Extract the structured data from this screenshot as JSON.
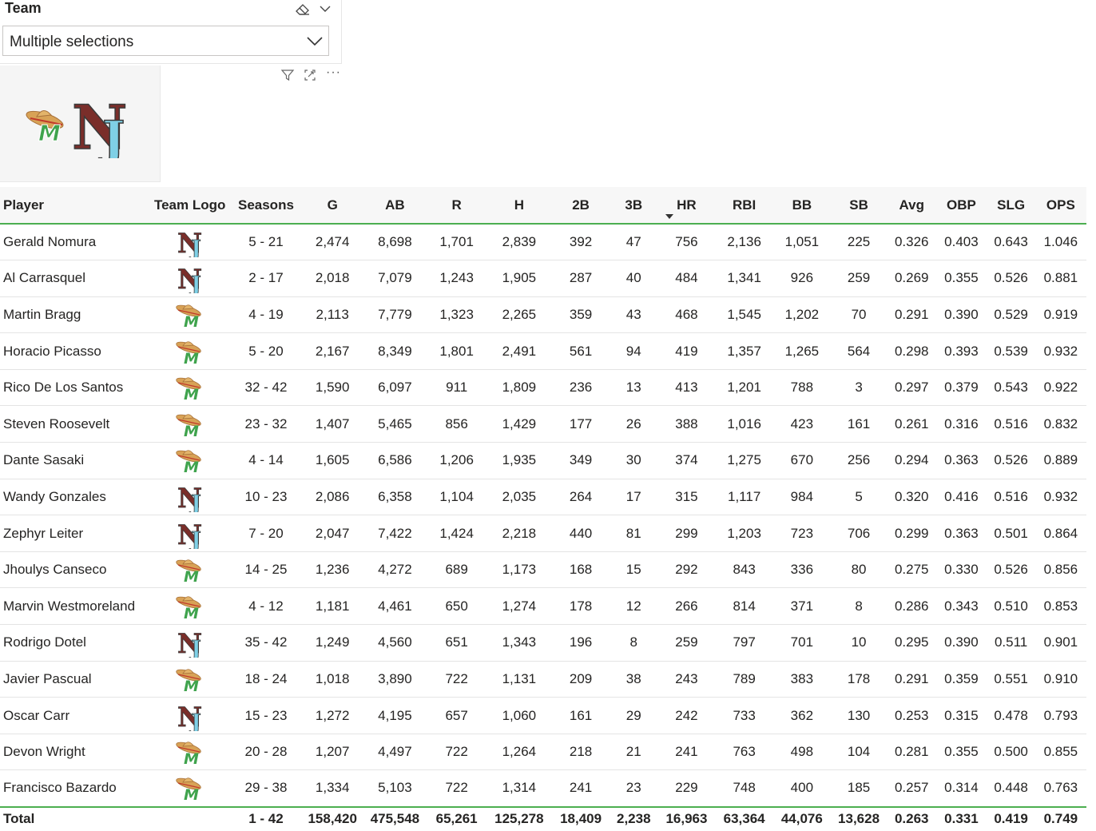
{
  "slicer": {
    "title": "Team",
    "value": "Multiple selections"
  },
  "logos": {
    "m_logo_text": "M",
    "nj_logo_text": "NJ"
  },
  "table": {
    "headers": [
      "Player",
      "Team Logo",
      "Seasons",
      "G",
      "AB",
      "R",
      "H",
      "2B",
      "3B",
      "HR",
      "RBI",
      "BB",
      "SB",
      "Avg",
      "OBP",
      "SLG",
      "OPS"
    ],
    "sorted_column": "HR",
    "rows": [
      {
        "player": "Gerald Nomura",
        "team": "nj",
        "seasons": "5 - 21",
        "g": "2,474",
        "ab": "8,698",
        "r": "1,701",
        "h": "2,839",
        "b2": "392",
        "b3": "47",
        "hr": "756",
        "rbi": "2,136",
        "bb": "1,051",
        "sb": "225",
        "avg": "0.326",
        "obp": "0.403",
        "slg": "0.643",
        "ops": "1.046"
      },
      {
        "player": "Al Carrasquel",
        "team": "nj",
        "seasons": "2 - 17",
        "g": "2,018",
        "ab": "7,079",
        "r": "1,243",
        "h": "1,905",
        "b2": "287",
        "b3": "40",
        "hr": "484",
        "rbi": "1,341",
        "bb": "926",
        "sb": "259",
        "avg": "0.269",
        "obp": "0.355",
        "slg": "0.526",
        "ops": "0.881"
      },
      {
        "player": "Martin Bragg",
        "team": "m",
        "seasons": "4 - 19",
        "g": "2,113",
        "ab": "7,779",
        "r": "1,323",
        "h": "2,265",
        "b2": "359",
        "b3": "43",
        "hr": "468",
        "rbi": "1,545",
        "bb": "1,202",
        "sb": "70",
        "avg": "0.291",
        "obp": "0.390",
        "slg": "0.529",
        "ops": "0.919"
      },
      {
        "player": "Horacio Picasso",
        "team": "m",
        "seasons": "5 - 20",
        "g": "2,167",
        "ab": "8,349",
        "r": "1,801",
        "h": "2,491",
        "b2": "561",
        "b3": "94",
        "hr": "419",
        "rbi": "1,357",
        "bb": "1,265",
        "sb": "564",
        "avg": "0.298",
        "obp": "0.393",
        "slg": "0.539",
        "ops": "0.932"
      },
      {
        "player": "Rico De Los Santos",
        "team": "m",
        "seasons": "32 - 42",
        "g": "1,590",
        "ab": "6,097",
        "r": "911",
        "h": "1,809",
        "b2": "236",
        "b3": "13",
        "hr": "413",
        "rbi": "1,201",
        "bb": "788",
        "sb": "3",
        "avg": "0.297",
        "obp": "0.379",
        "slg": "0.543",
        "ops": "0.922"
      },
      {
        "player": "Steven Roosevelt",
        "team": "m",
        "seasons": "23 - 32",
        "g": "1,407",
        "ab": "5,465",
        "r": "856",
        "h": "1,429",
        "b2": "177",
        "b3": "26",
        "hr": "388",
        "rbi": "1,016",
        "bb": "423",
        "sb": "161",
        "avg": "0.261",
        "obp": "0.316",
        "slg": "0.516",
        "ops": "0.832"
      },
      {
        "player": "Dante Sasaki",
        "team": "m",
        "seasons": "4 - 14",
        "g": "1,605",
        "ab": "6,586",
        "r": "1,206",
        "h": "1,935",
        "b2": "349",
        "b3": "30",
        "hr": "374",
        "rbi": "1,275",
        "bb": "670",
        "sb": "256",
        "avg": "0.294",
        "obp": "0.363",
        "slg": "0.526",
        "ops": "0.889"
      },
      {
        "player": "Wandy Gonzales",
        "team": "nj",
        "seasons": "10 - 23",
        "g": "2,086",
        "ab": "6,358",
        "r": "1,104",
        "h": "2,035",
        "b2": "264",
        "b3": "17",
        "hr": "315",
        "rbi": "1,117",
        "bb": "984",
        "sb": "5",
        "avg": "0.320",
        "obp": "0.416",
        "slg": "0.516",
        "ops": "0.932"
      },
      {
        "player": "Zephyr Leiter",
        "team": "nj",
        "seasons": "7 - 20",
        "g": "2,047",
        "ab": "7,422",
        "r": "1,424",
        "h": "2,218",
        "b2": "440",
        "b3": "81",
        "hr": "299",
        "rbi": "1,203",
        "bb": "723",
        "sb": "706",
        "avg": "0.299",
        "obp": "0.363",
        "slg": "0.501",
        "ops": "0.864"
      },
      {
        "player": "Jhoulys Canseco",
        "team": "m",
        "seasons": "14 - 25",
        "g": "1,236",
        "ab": "4,272",
        "r": "689",
        "h": "1,173",
        "b2": "168",
        "b3": "15",
        "hr": "292",
        "rbi": "843",
        "bb": "336",
        "sb": "80",
        "avg": "0.275",
        "obp": "0.330",
        "slg": "0.526",
        "ops": "0.856"
      },
      {
        "player": "Marvin Westmoreland",
        "team": "m",
        "seasons": "4 - 12",
        "g": "1,181",
        "ab": "4,461",
        "r": "650",
        "h": "1,274",
        "b2": "178",
        "b3": "12",
        "hr": "266",
        "rbi": "814",
        "bb": "371",
        "sb": "8",
        "avg": "0.286",
        "obp": "0.343",
        "slg": "0.510",
        "ops": "0.853"
      },
      {
        "player": "Rodrigo Dotel",
        "team": "nj",
        "seasons": "35 - 42",
        "g": "1,249",
        "ab": "4,560",
        "r": "651",
        "h": "1,343",
        "b2": "196",
        "b3": "8",
        "hr": "259",
        "rbi": "797",
        "bb": "701",
        "sb": "10",
        "avg": "0.295",
        "obp": "0.390",
        "slg": "0.511",
        "ops": "0.901"
      },
      {
        "player": "Javier Pascual",
        "team": "m",
        "seasons": "18 - 24",
        "g": "1,018",
        "ab": "3,890",
        "r": "722",
        "h": "1,131",
        "b2": "209",
        "b3": "38",
        "hr": "243",
        "rbi": "789",
        "bb": "383",
        "sb": "178",
        "avg": "0.291",
        "obp": "0.359",
        "slg": "0.551",
        "ops": "0.910"
      },
      {
        "player": "Oscar Carr",
        "team": "nj",
        "seasons": "15 - 23",
        "g": "1,272",
        "ab": "4,195",
        "r": "657",
        "h": "1,060",
        "b2": "161",
        "b3": "29",
        "hr": "242",
        "rbi": "733",
        "bb": "362",
        "sb": "130",
        "avg": "0.253",
        "obp": "0.315",
        "slg": "0.478",
        "ops": "0.793"
      },
      {
        "player": "Devon Wright",
        "team": "m",
        "seasons": "20 - 28",
        "g": "1,207",
        "ab": "4,497",
        "r": "722",
        "h": "1,264",
        "b2": "218",
        "b3": "21",
        "hr": "241",
        "rbi": "763",
        "bb": "498",
        "sb": "104",
        "avg": "0.281",
        "obp": "0.355",
        "slg": "0.500",
        "ops": "0.855"
      },
      {
        "player": "Francisco Bazardo",
        "team": "m",
        "seasons": "29 - 38",
        "g": "1,334",
        "ab": "5,103",
        "r": "722",
        "h": "1,314",
        "b2": "241",
        "b3": "23",
        "hr": "229",
        "rbi": "748",
        "bb": "400",
        "sb": "185",
        "avg": "0.257",
        "obp": "0.314",
        "slg": "0.448",
        "ops": "0.763"
      }
    ],
    "total": {
      "player": "Total",
      "team": "",
      "seasons": "1 - 42",
      "g": "158,420",
      "ab": "475,548",
      "r": "65,261",
      "h": "125,278",
      "b2": "18,409",
      "b3": "2,238",
      "hr": "16,963",
      "rbi": "63,364",
      "bb": "44,076",
      "sb": "13,628",
      "avg": "0.263",
      "obp": "0.331",
      "slg": "0.419",
      "ops": "0.749"
    }
  },
  "colors": {
    "accent": "#4caf50",
    "nj_maroon": "#7a2e2a",
    "nj_blue": "#7fd0e6",
    "m_green": "#3fa34d",
    "sombrero": "#d8a256"
  }
}
